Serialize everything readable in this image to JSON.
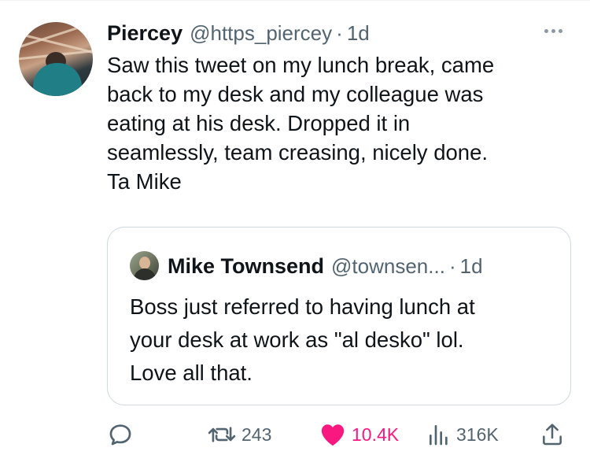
{
  "tweet": {
    "author_name": "Piercey",
    "author_handle": "@https_piercey",
    "separator": "·",
    "time": "1d",
    "text": "Saw this tweet on my lunch break, came\nback to my desk and my colleague was\neating at his desk. Dropped it in\nseamlessly, team creasing, nicely done.\nTa Mike"
  },
  "quoted_tweet": {
    "author_name": "Mike Townsend",
    "author_handle": "@townsen...",
    "separator": "·",
    "time": "1d",
    "text": "Boss just referred to having lunch at\nyour desk at work as \"al desko\" lol.\nLove all that."
  },
  "actions": {
    "reply_count": "",
    "retweet_count": "243",
    "like_count": "10.4K",
    "views_count": "316K"
  },
  "colors": {
    "text_primary": "#0f1419",
    "text_secondary": "#536471",
    "like_pink": "#f91880",
    "border": "#cfd9de"
  },
  "icons": {
    "reply": "reply-icon",
    "retweet": "retweet-icon",
    "like": "heart-filled-icon",
    "views": "views-chart-icon",
    "share": "share-icon",
    "more": "more-dots-icon"
  }
}
